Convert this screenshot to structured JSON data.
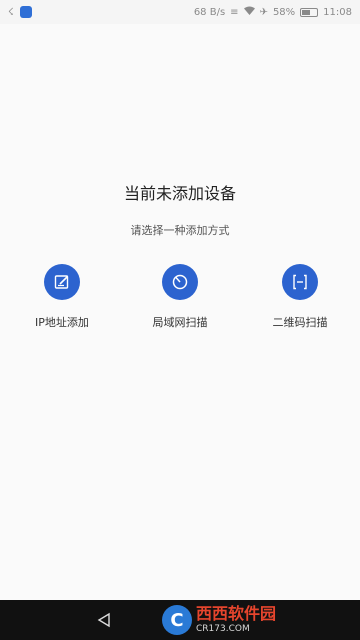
{
  "status_bar": {
    "network_speed": "68 B/s",
    "battery_percent": "58%",
    "battery_level": 0.58,
    "time": "11:08"
  },
  "empty_state": {
    "title": "当前未添加设备",
    "subtitle": "请选择一种添加方式"
  },
  "options": [
    {
      "label": "IP地址添加",
      "icon": "edit-icon"
    },
    {
      "label": "局域网扫描",
      "icon": "radar-icon"
    },
    {
      "label": "二维码扫描",
      "icon": "scan-icon"
    }
  ],
  "colors": {
    "accent": "#2c63cf",
    "nav_bar": "#111111"
  },
  "watermark": {
    "brand": "西西软件园",
    "domain": "CR173.COM"
  }
}
